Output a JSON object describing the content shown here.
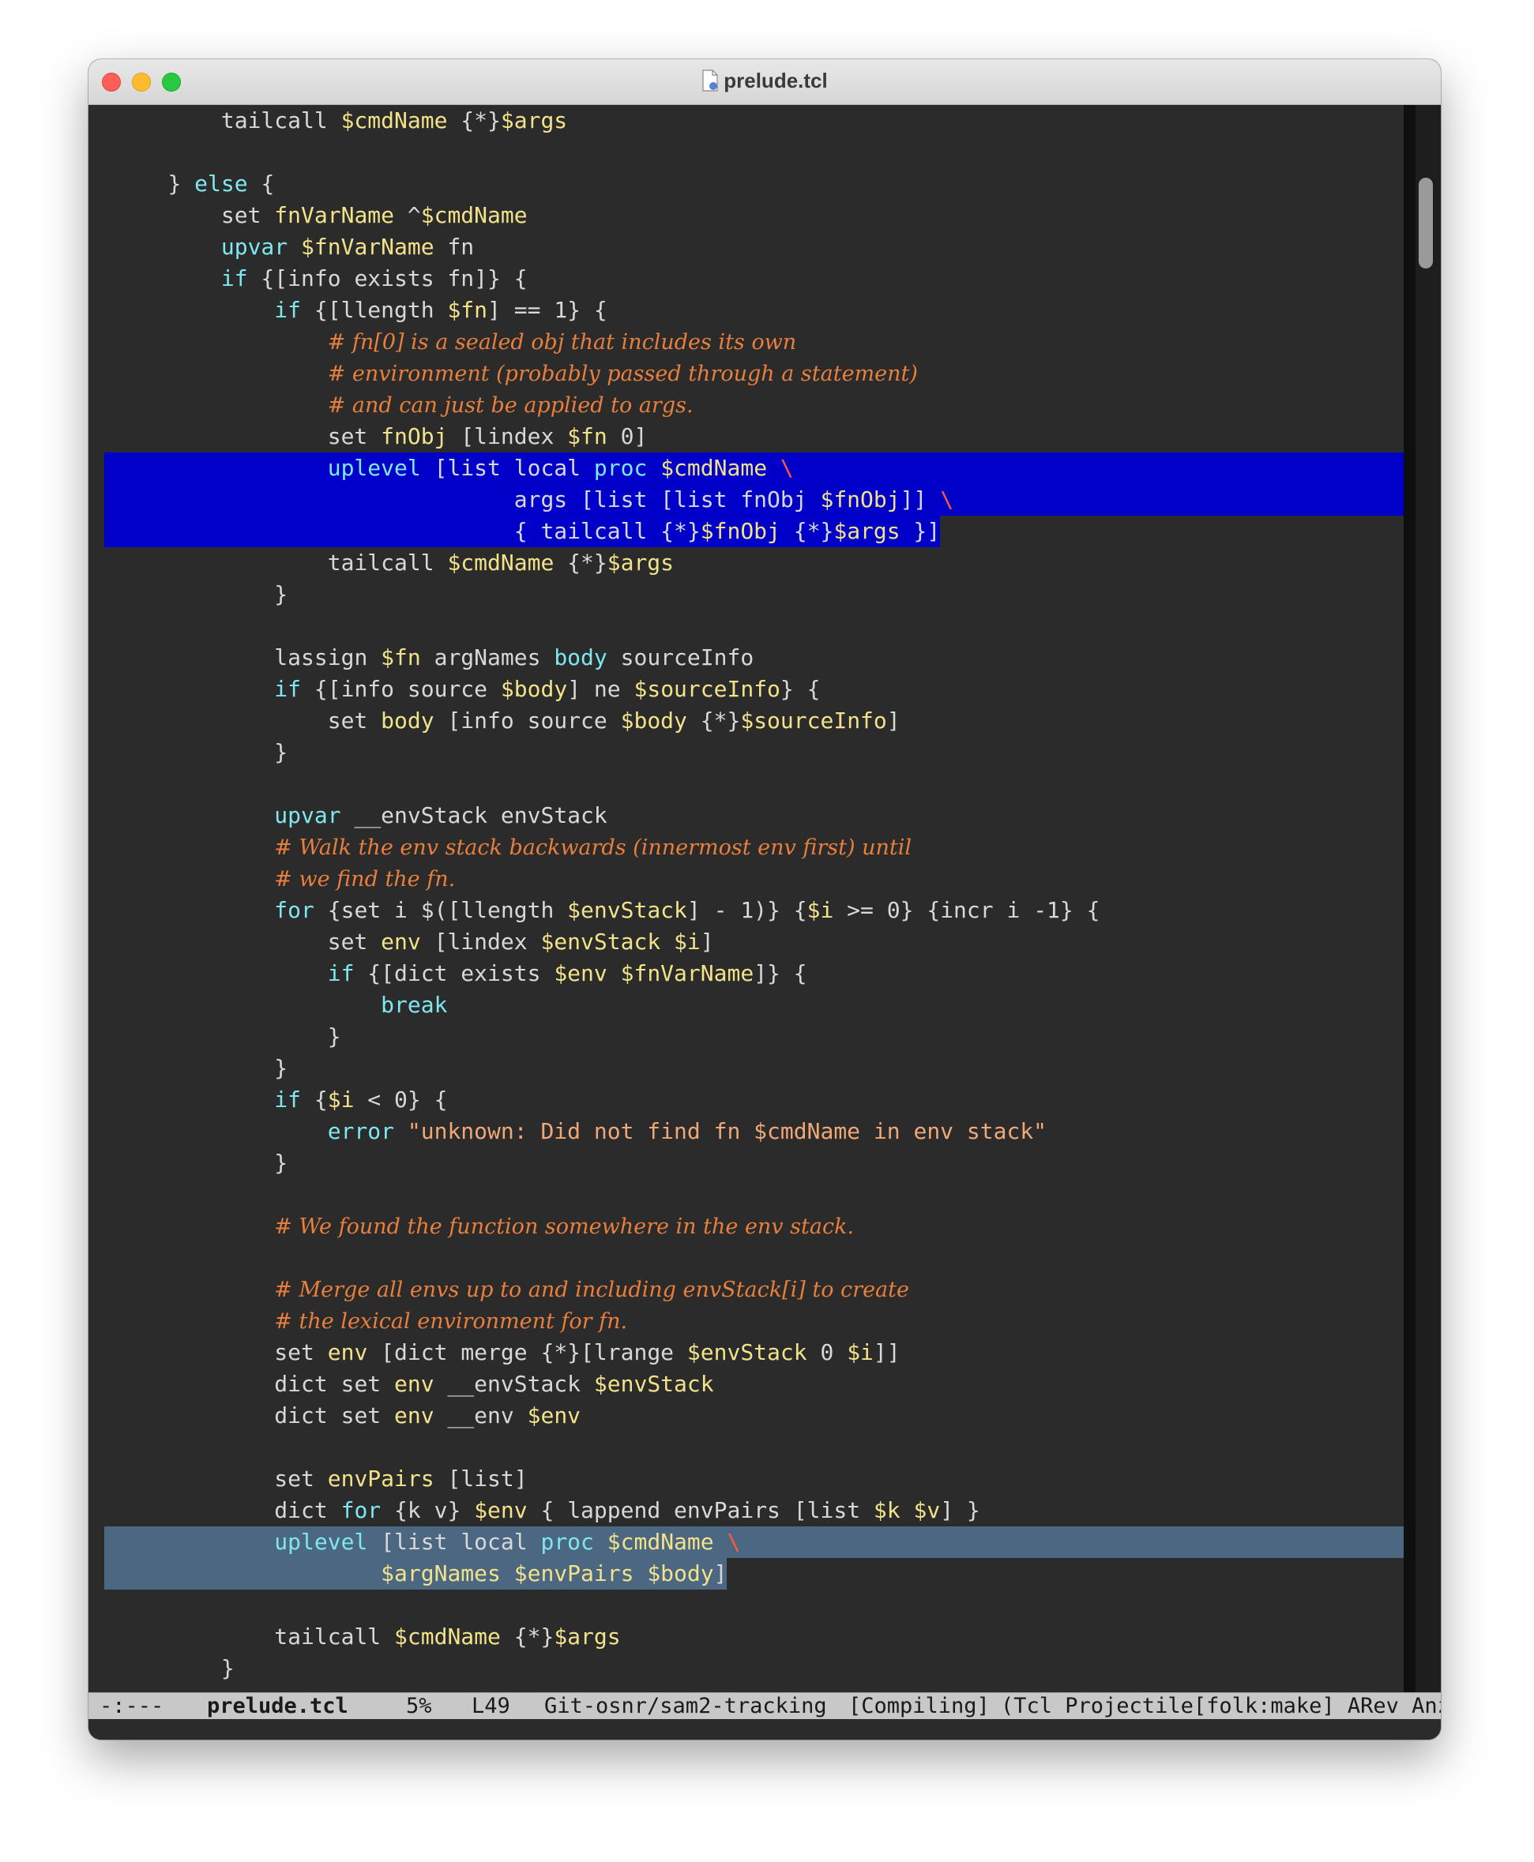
{
  "window": {
    "title": "prelude.tcl",
    "controls": [
      "close",
      "minimize",
      "maximize"
    ]
  },
  "code_lines": [
    {
      "indent": 2,
      "seg": [
        [
          "",
          "tailcall "
        ],
        [
          "vn",
          "$cmdName"
        ],
        [
          "",
          " {*}"
        ],
        [
          "vn",
          "$args"
        ]
      ]
    },
    {
      "indent": 0,
      "seg": []
    },
    {
      "indent": 1,
      "seg": [
        [
          "",
          "} "
        ],
        [
          "kw",
          "else"
        ],
        [
          "",
          " {"
        ]
      ]
    },
    {
      "indent": 2,
      "seg": [
        [
          "",
          "set "
        ],
        [
          "vn",
          "fnVarName"
        ],
        [
          "",
          " ^"
        ],
        [
          "vn",
          "$cmdName"
        ]
      ]
    },
    {
      "indent": 2,
      "seg": [
        [
          "kw",
          "upvar"
        ],
        [
          "",
          " "
        ],
        [
          "vn",
          "$fnVarName"
        ],
        [
          "",
          " fn"
        ]
      ]
    },
    {
      "indent": 2,
      "seg": [
        [
          "kw",
          "if"
        ],
        [
          "",
          " {[info exists fn]} {"
        ]
      ]
    },
    {
      "indent": 3,
      "seg": [
        [
          "kw",
          "if"
        ],
        [
          "",
          " {[llength "
        ],
        [
          "vn",
          "$fn"
        ],
        [
          "",
          "] == 1} {"
        ]
      ]
    },
    {
      "indent": 4,
      "seg": [
        [
          "cm",
          "# fn[0] is a sealed obj that includes its own"
        ]
      ]
    },
    {
      "indent": 4,
      "seg": [
        [
          "cm",
          "# environment (probably passed through a statement)"
        ]
      ]
    },
    {
      "indent": 4,
      "seg": [
        [
          "cm",
          "# and can just be applied to args."
        ]
      ]
    },
    {
      "indent": 4,
      "seg": [
        [
          "",
          "set "
        ],
        [
          "vn",
          "fnObj"
        ],
        [
          "",
          " [lindex "
        ],
        [
          "vn",
          "$fn"
        ],
        [
          "",
          " 0]"
        ]
      ]
    },
    {
      "indent": 4,
      "hl": "blue",
      "seg": [
        [
          "kw",
          "uplevel"
        ],
        [
          "",
          " [list local "
        ],
        [
          "kw",
          "proc"
        ],
        [
          "",
          " "
        ],
        [
          "vn",
          "$cmdName"
        ],
        [
          "",
          " "
        ],
        [
          "bs",
          "\\"
        ]
      ]
    },
    {
      "indent": 0,
      "hl": "blue",
      "pad": "                              ",
      "seg": [
        [
          "",
          "args [list [list fnObj "
        ],
        [
          "vn",
          "$fnObj"
        ],
        [
          "",
          "]] "
        ],
        [
          "bs",
          "\\"
        ]
      ]
    },
    {
      "indent": 0,
      "hl": "blue-partial",
      "pad": "                              ",
      "seg": [
        [
          "",
          "{ tailcall {*}"
        ],
        [
          "vn",
          "$fnObj"
        ],
        [
          "",
          " {*}"
        ],
        [
          "vn",
          "$args"
        ],
        [
          "",
          " }]"
        ]
      ]
    },
    {
      "indent": 4,
      "seg": [
        [
          "",
          "tailcall "
        ],
        [
          "vn",
          "$cmdName"
        ],
        [
          "",
          " {*}"
        ],
        [
          "vn",
          "$args"
        ]
      ]
    },
    {
      "indent": 3,
      "seg": [
        [
          "",
          "}"
        ]
      ]
    },
    {
      "indent": 0,
      "seg": []
    },
    {
      "indent": 3,
      "seg": [
        [
          "",
          "lassign "
        ],
        [
          "vn",
          "$fn"
        ],
        [
          "",
          " argNames "
        ],
        [
          "kw",
          "body"
        ],
        [
          "",
          " sourceInfo"
        ]
      ]
    },
    {
      "indent": 3,
      "seg": [
        [
          "kw",
          "if"
        ],
        [
          "",
          " {[info source "
        ],
        [
          "vn",
          "$body"
        ],
        [
          "",
          "] ne "
        ],
        [
          "vn",
          "$sourceInfo"
        ],
        [
          "",
          "} {"
        ]
      ]
    },
    {
      "indent": 4,
      "seg": [
        [
          "",
          "set "
        ],
        [
          "vn",
          "body"
        ],
        [
          "",
          " [info source "
        ],
        [
          "vn",
          "$body"
        ],
        [
          "",
          " {*}"
        ],
        [
          "vn",
          "$sourceInfo"
        ],
        [
          "",
          "]"
        ]
      ]
    },
    {
      "indent": 3,
      "seg": [
        [
          "",
          "}"
        ]
      ]
    },
    {
      "indent": 0,
      "seg": []
    },
    {
      "indent": 3,
      "seg": [
        [
          "kw",
          "upvar"
        ],
        [
          "",
          " __envStack envStack"
        ]
      ]
    },
    {
      "indent": 3,
      "seg": [
        [
          "cm",
          "# Walk the env stack backwards (innermost env first) until"
        ]
      ]
    },
    {
      "indent": 3,
      "seg": [
        [
          "cm",
          "# we find the fn."
        ]
      ]
    },
    {
      "indent": 3,
      "seg": [
        [
          "kw",
          "for"
        ],
        [
          "",
          " {set i $([llength "
        ],
        [
          "vn",
          "$envStack"
        ],
        [
          "",
          "] - 1)} {"
        ],
        [
          "vn",
          "$i"
        ],
        [
          "",
          " >= 0} {incr i -1} {"
        ]
      ]
    },
    {
      "indent": 4,
      "seg": [
        [
          "",
          "set "
        ],
        [
          "vn",
          "env"
        ],
        [
          "",
          " [lindex "
        ],
        [
          "vn",
          "$envStack"
        ],
        [
          "",
          " "
        ],
        [
          "vn",
          "$i"
        ],
        [
          "",
          "]"
        ]
      ]
    },
    {
      "indent": 4,
      "seg": [
        [
          "kw",
          "if"
        ],
        [
          "",
          " {[dict exists "
        ],
        [
          "vn",
          "$env"
        ],
        [
          "",
          " "
        ],
        [
          "vn",
          "$fnVarName"
        ],
        [
          "",
          "]} {"
        ]
      ]
    },
    {
      "indent": 5,
      "seg": [
        [
          "kw",
          "break"
        ]
      ]
    },
    {
      "indent": 4,
      "seg": [
        [
          "",
          "}"
        ]
      ]
    },
    {
      "indent": 3,
      "seg": [
        [
          "",
          "}"
        ]
      ]
    },
    {
      "indent": 3,
      "seg": [
        [
          "kw",
          "if"
        ],
        [
          "",
          " {"
        ],
        [
          "vn",
          "$i"
        ],
        [
          "",
          " < 0} {"
        ]
      ]
    },
    {
      "indent": 4,
      "seg": [
        [
          "kw",
          "error"
        ],
        [
          "",
          " "
        ],
        [
          "str",
          "\"unknown: Did not find fn $cmdName in env stack\""
        ]
      ]
    },
    {
      "indent": 3,
      "seg": [
        [
          "",
          "}"
        ]
      ]
    },
    {
      "indent": 0,
      "seg": []
    },
    {
      "indent": 3,
      "seg": [
        [
          "cm",
          "# We found the function somewhere in the env stack."
        ]
      ]
    },
    {
      "indent": 0,
      "seg": []
    },
    {
      "indent": 3,
      "seg": [
        [
          "cm",
          "# Merge all envs up to and including envStack[i] to create"
        ]
      ]
    },
    {
      "indent": 3,
      "seg": [
        [
          "cm",
          "# the lexical environment for fn."
        ]
      ]
    },
    {
      "indent": 3,
      "seg": [
        [
          "",
          "set "
        ],
        [
          "vn",
          "env"
        ],
        [
          "",
          " [dict merge {*}[lrange "
        ],
        [
          "vn",
          "$envStack"
        ],
        [
          "",
          " 0 "
        ],
        [
          "vn",
          "$i"
        ],
        [
          "",
          "]]"
        ]
      ]
    },
    {
      "indent": 3,
      "seg": [
        [
          "",
          "dict set "
        ],
        [
          "vn",
          "env"
        ],
        [
          "",
          " __envStack "
        ],
        [
          "vn",
          "$envStack"
        ]
      ]
    },
    {
      "indent": 3,
      "seg": [
        [
          "",
          "dict set "
        ],
        [
          "vn",
          "env"
        ],
        [
          "",
          " __env "
        ],
        [
          "vn",
          "$env"
        ]
      ]
    },
    {
      "indent": 0,
      "seg": []
    },
    {
      "indent": 3,
      "seg": [
        [
          "",
          "set "
        ],
        [
          "vn",
          "envPairs"
        ],
        [
          "",
          " [list]"
        ]
      ]
    },
    {
      "indent": 3,
      "seg": [
        [
          "",
          "dict "
        ],
        [
          "kw",
          "for"
        ],
        [
          "",
          " {k v} "
        ],
        [
          "vn",
          "$env"
        ],
        [
          "",
          " { lappend envPairs [list "
        ],
        [
          "vn",
          "$k"
        ],
        [
          "",
          " "
        ],
        [
          "vn",
          "$v"
        ],
        [
          "",
          "] }"
        ]
      ]
    },
    {
      "indent": 3,
      "hl": "gray",
      "seg": [
        [
          "kw",
          "uplevel"
        ],
        [
          "",
          " [list local "
        ],
        [
          "kw",
          "proc"
        ],
        [
          "",
          " "
        ],
        [
          "vn",
          "$cmdName"
        ],
        [
          "",
          " "
        ],
        [
          "bs",
          "\\"
        ]
      ]
    },
    {
      "indent": 0,
      "hl": "gray-partial",
      "pad": "                    ",
      "seg": [
        [
          "vn",
          "$argNames"
        ],
        [
          "",
          " "
        ],
        [
          "vn",
          "$envPairs"
        ],
        [
          "",
          " "
        ],
        [
          "vn",
          "$body"
        ],
        [
          "",
          "]"
        ]
      ]
    },
    {
      "indent": 0,
      "seg": []
    },
    {
      "indent": 3,
      "seg": [
        [
          "",
          "tailcall "
        ],
        [
          "vn",
          "$cmdName"
        ],
        [
          "",
          " {*}"
        ],
        [
          "vn",
          "$args"
        ]
      ]
    },
    {
      "indent": 2,
      "seg": [
        [
          "",
          "}"
        ]
      ]
    }
  ],
  "modeline": {
    "status": "-:---",
    "filename": "prelude.tcl",
    "position": "5%",
    "line": "L49",
    "vcs": "Git-osnr/sam2-tracking",
    "compile": "[Compiling]",
    "modes": "(Tcl Projectile[folk:make] ARev Anz"
  },
  "colors": {
    "background": "#2b2b2b",
    "keyword": "#7fe7ee",
    "variable": "#f2e28a",
    "comment": "#e87f3c",
    "string": "#f0a878",
    "region_highlight": "#0000c8",
    "secondary_highlight": "#4c6781"
  }
}
